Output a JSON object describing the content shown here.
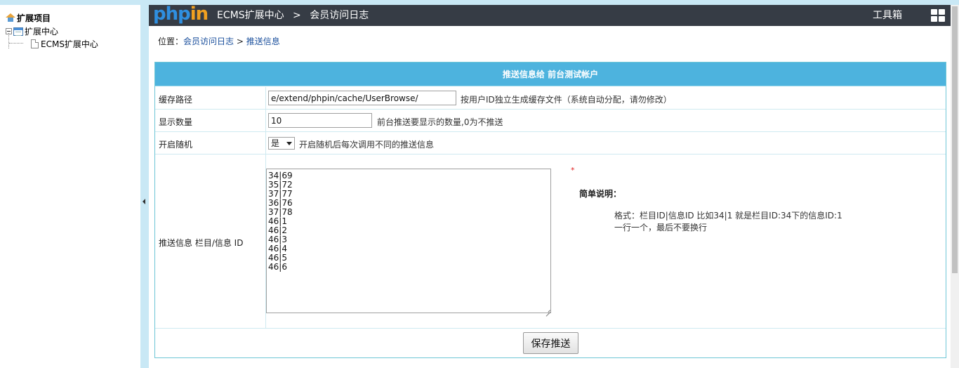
{
  "sidebar": {
    "root_label": "扩展项目",
    "node1_label": "扩展中心",
    "node2_label": "ECMS扩展中心"
  },
  "header": {
    "logo_text_a": "php",
    "logo_text_b": "in",
    "title_part1": "ECMS扩展中心",
    "title_sep": ">",
    "title_part2": "会员访问日志",
    "toolbox_label": "工具箱"
  },
  "breadcrumb": {
    "prefix": "位置：",
    "link1": "会员访问日志",
    "sep": " > ",
    "link2": "推送信息"
  },
  "form": {
    "title": "推送信息给 前台测试帐户",
    "cache_path": {
      "label": "缓存路径",
      "value": "e/extend/phpin/cache/UserBrowse/",
      "hint": "按用户ID独立生成缓存文件（系统自动分配，请勿修改）"
    },
    "display_count": {
      "label": "显示数量",
      "value": "10",
      "hint": "前台推送要显示的数量,0为不推送"
    },
    "random": {
      "label": "开启随机",
      "selected": "是",
      "hint": "开启随机后每次调用不同的推送信息"
    },
    "push_info": {
      "label": "推送信息 栏目/信息 ID",
      "value": "34|69\n35|72\n37|77\n36|76\n37|78\n46|1\n46|2\n46|3\n46|4\n46|5\n46|6",
      "required_mark": "*",
      "desc_title": "简单说明：",
      "desc_line1": "格式：栏目ID|信息ID 比如34|1 就是栏目ID:34下的信息ID:1",
      "desc_line2": "一行一个，最后不要换行"
    },
    "save_label": "保存推送"
  }
}
